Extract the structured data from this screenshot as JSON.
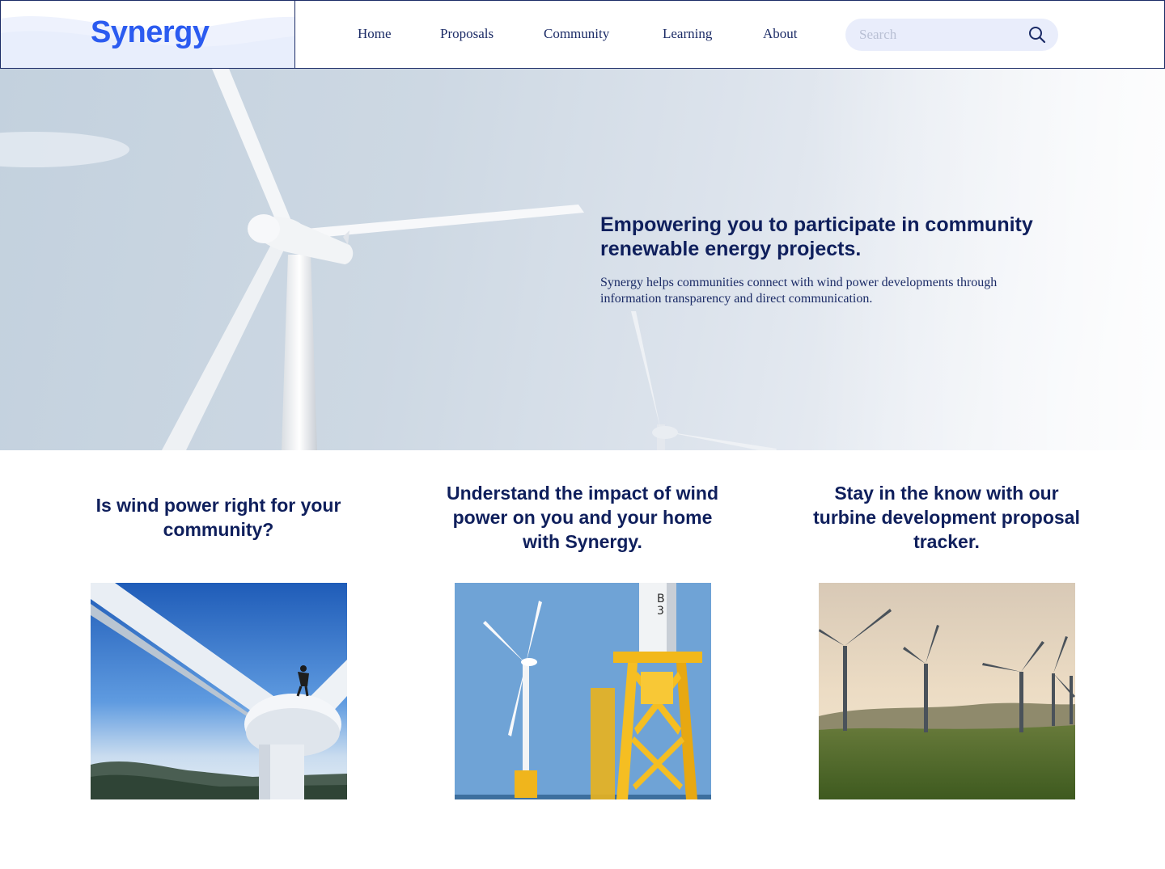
{
  "brand": {
    "logo_text": "Synergy",
    "color": "#2b5bf0"
  },
  "nav": {
    "items": [
      {
        "label": "Home"
      },
      {
        "label": "Proposals"
      },
      {
        "label": "Community"
      },
      {
        "label": "Learning"
      },
      {
        "label": "About"
      }
    ]
  },
  "search": {
    "placeholder": "Search",
    "icon": "search-icon"
  },
  "hero": {
    "title": "Empowering you to participate in community renewable energy projects.",
    "subtitle": "Synergy helps communities connect with wind power developments through information transparency and direct communication.",
    "image": "wind-turbine-photo"
  },
  "features": [
    {
      "heading": "Is wind power right for your community?",
      "image": "turbine-technician-photo"
    },
    {
      "heading": "Understand the impact of wind power on you and your home with Synergy.",
      "image": "offshore-turbine-photo"
    },
    {
      "heading": "Stay in the know with our turbine development proposal tracker.",
      "image": "wind-farm-field-photo"
    }
  ],
  "colors": {
    "navy": "#0f1f5c",
    "accent": "#2b5bf0",
    "search_bg": "#e9edfb"
  }
}
